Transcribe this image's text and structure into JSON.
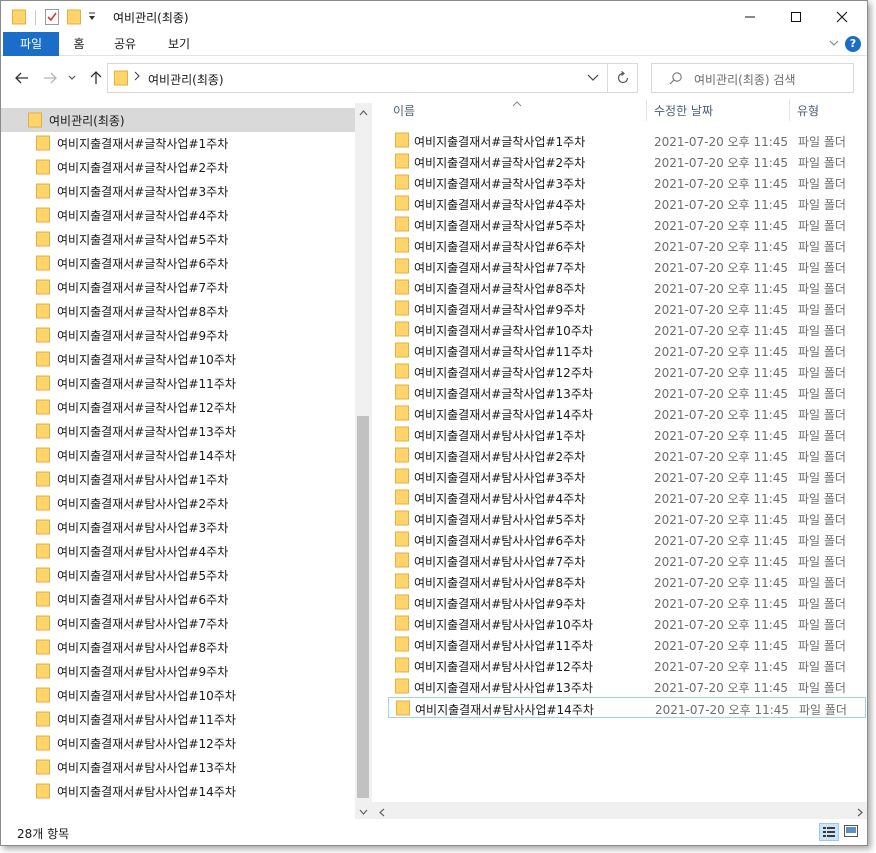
{
  "window": {
    "title": "여비관리(최종)"
  },
  "ribbon": {
    "tabs": [
      "파일",
      "홈",
      "공유",
      "보기"
    ],
    "help": "?"
  },
  "address": {
    "path": "여비관리(최종)"
  },
  "search": {
    "placeholder": "여비관리(최종) 검색"
  },
  "nav": {
    "root": "여비관리(최종)",
    "items": [
      "여비지출결재서#글착사업#1주차",
      "여비지출결재서#글착사업#2주차",
      "여비지출결재서#글착사업#3주차",
      "여비지출결재서#글착사업#4주차",
      "여비지출결재서#글착사업#5주차",
      "여비지출결재서#글착사업#6주차",
      "여비지출결재서#글착사업#7주차",
      "여비지출결재서#글착사업#8주차",
      "여비지출결재서#글착사업#9주차",
      "여비지출결재서#글착사업#10주차",
      "여비지출결재서#글착사업#11주차",
      "여비지출결재서#글착사업#12주차",
      "여비지출결재서#글착사업#13주차",
      "여비지출결재서#글착사업#14주차",
      "여비지출결재서#탐사사업#1주차",
      "여비지출결재서#탐사사업#2주차",
      "여비지출결재서#탐사사업#3주차",
      "여비지출결재서#탐사사업#4주차",
      "여비지출결재서#탐사사업#5주차",
      "여비지출결재서#탐사사업#6주차",
      "여비지출결재서#탐사사업#7주차",
      "여비지출결재서#탐사사업#8주차",
      "여비지출결재서#탐사사업#9주차",
      "여비지출결재서#탐사사업#10주차",
      "여비지출결재서#탐사사업#11주차",
      "여비지출결재서#탐사사업#12주차",
      "여비지출결재서#탐사사업#13주차",
      "여비지출결재서#탐사사업#14주차"
    ]
  },
  "columns": {
    "name": "이름",
    "date": "수정한 날짜",
    "type": "유형"
  },
  "files": {
    "date": "2021-07-20 오후 11:45",
    "type": "파일 폴더",
    "names": [
      "여비지출결재서#글착사업#1주차",
      "여비지출결재서#글착사업#2주차",
      "여비지출결재서#글착사업#3주차",
      "여비지출결재서#글착사업#4주차",
      "여비지출결재서#글착사업#5주차",
      "여비지출결재서#글착사업#6주차",
      "여비지출결재서#글착사업#7주차",
      "여비지출결재서#글착사업#8주차",
      "여비지출결재서#글착사업#9주차",
      "여비지출결재서#글착사업#10주차",
      "여비지출결재서#글착사업#11주차",
      "여비지출결재서#글착사업#12주차",
      "여비지출결재서#글착사업#13주차",
      "여비지출결재서#글착사업#14주차",
      "여비지출결재서#탐사사업#1주차",
      "여비지출결재서#탐사사업#2주차",
      "여비지출결재서#탐사사업#3주차",
      "여비지출결재서#탐사사업#4주차",
      "여비지출결재서#탐사사업#5주차",
      "여비지출결재서#탐사사업#6주차",
      "여비지출결재서#탐사사업#7주차",
      "여비지출결재서#탐사사업#8주차",
      "여비지출결재서#탐사사업#9주차",
      "여비지출결재서#탐사사업#10주차",
      "여비지출결재서#탐사사업#11주차",
      "여비지출결재서#탐사사업#12주차",
      "여비지출결재서#탐사사업#13주차",
      "여비지출결재서#탐사사업#14주차"
    ],
    "selected_index": 27
  },
  "status": {
    "count": "28개 항목"
  },
  "colors": {
    "accent": "#1a6dc9",
    "folder": "#ffd56b",
    "selection_border": "#99d1ff",
    "nav_highlight": "#d9d9d9"
  }
}
